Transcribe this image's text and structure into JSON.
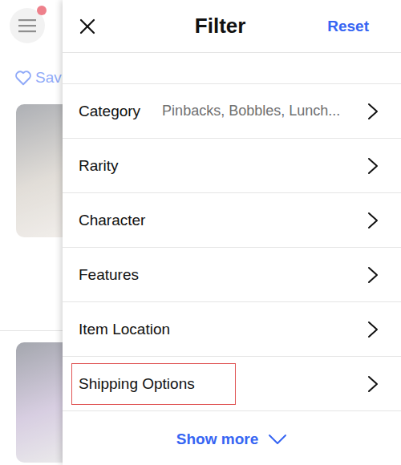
{
  "background": {
    "menu": {
      "notification": true
    },
    "save_label": "Sav"
  },
  "header": {
    "title": "Filter",
    "reset": "Reset"
  },
  "filters": [
    {
      "label": "Category",
      "value": "Pinbacks, Bobbles, Lunch...",
      "highlighted": false
    },
    {
      "label": "Rarity",
      "value": "",
      "highlighted": false
    },
    {
      "label": "Character",
      "value": "",
      "highlighted": false
    },
    {
      "label": "Features",
      "value": "",
      "highlighted": false
    },
    {
      "label": "Item Location",
      "value": "",
      "highlighted": false
    },
    {
      "label": "Shipping Options",
      "value": "",
      "highlighted": true
    }
  ],
  "show_more": "Show more"
}
